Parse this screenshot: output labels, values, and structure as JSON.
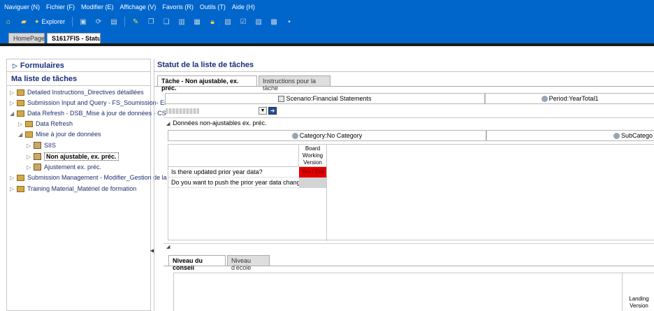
{
  "menu": [
    "Naviguer (N)",
    "Fichier (F)",
    "Modifier (E)",
    "Affichage (V)",
    "Favoris (R)",
    "Outils (T)",
    "Aide (H)"
  ],
  "toolbar": {
    "explorer_label": "Explorer"
  },
  "tabs": {
    "home": "HomePage",
    "status": "S1617FIS - Statu"
  },
  "left_panel": {
    "formulaires": "Formulaires",
    "task_list_title": "Ma liste de tâches",
    "tree": [
      {
        "label": "Detailed Instructions_Directives détaillées"
      },
      {
        "label": "Submission Input and Query - FS_Soumission- Er"
      },
      {
        "label": "Data Refresh - DSB_Mise à jour de données - CS"
      },
      {
        "label": "Data Refresh"
      },
      {
        "label": "Mise à jour de données"
      },
      {
        "label": "SIIS"
      },
      {
        "label": "Non ajustable, ex. préc."
      },
      {
        "label": "Ajustement ex. préc."
      },
      {
        "label": "Submission Management - Modifier_Gestion de la"
      },
      {
        "label": "Training Material_Matériel de formation"
      }
    ]
  },
  "right_panel": {
    "title": "Statut de la liste de tâches",
    "tab_active": "Tâche - Non ajustable, ex. préc.",
    "tab_other": "Instructions pour la tâche",
    "pov_scenario": "Scenario:Financial Statements",
    "pov_period": "Period:YearTotal1",
    "grid_title": "Données non-ajustables ex. préc.",
    "pov_category": "Category:No Category",
    "pov_subcategory": "SubCatego",
    "column_header": "Board Working Version",
    "rows": [
      {
        "label": "Is there updated prior year data?",
        "value": "Yes / Oui"
      },
      {
        "label": "Do you want to push the prior year data change?",
        "value": ""
      }
    ],
    "bottom_tab_active": "Niveau du conseil",
    "bottom_tab_other": "Niveau d'école",
    "bottom_column_header": "Landing Version"
  },
  "colors": {
    "menubar": "#0066cc",
    "highlight_cell": "#e00000",
    "title_text": "#1a2f7a"
  }
}
